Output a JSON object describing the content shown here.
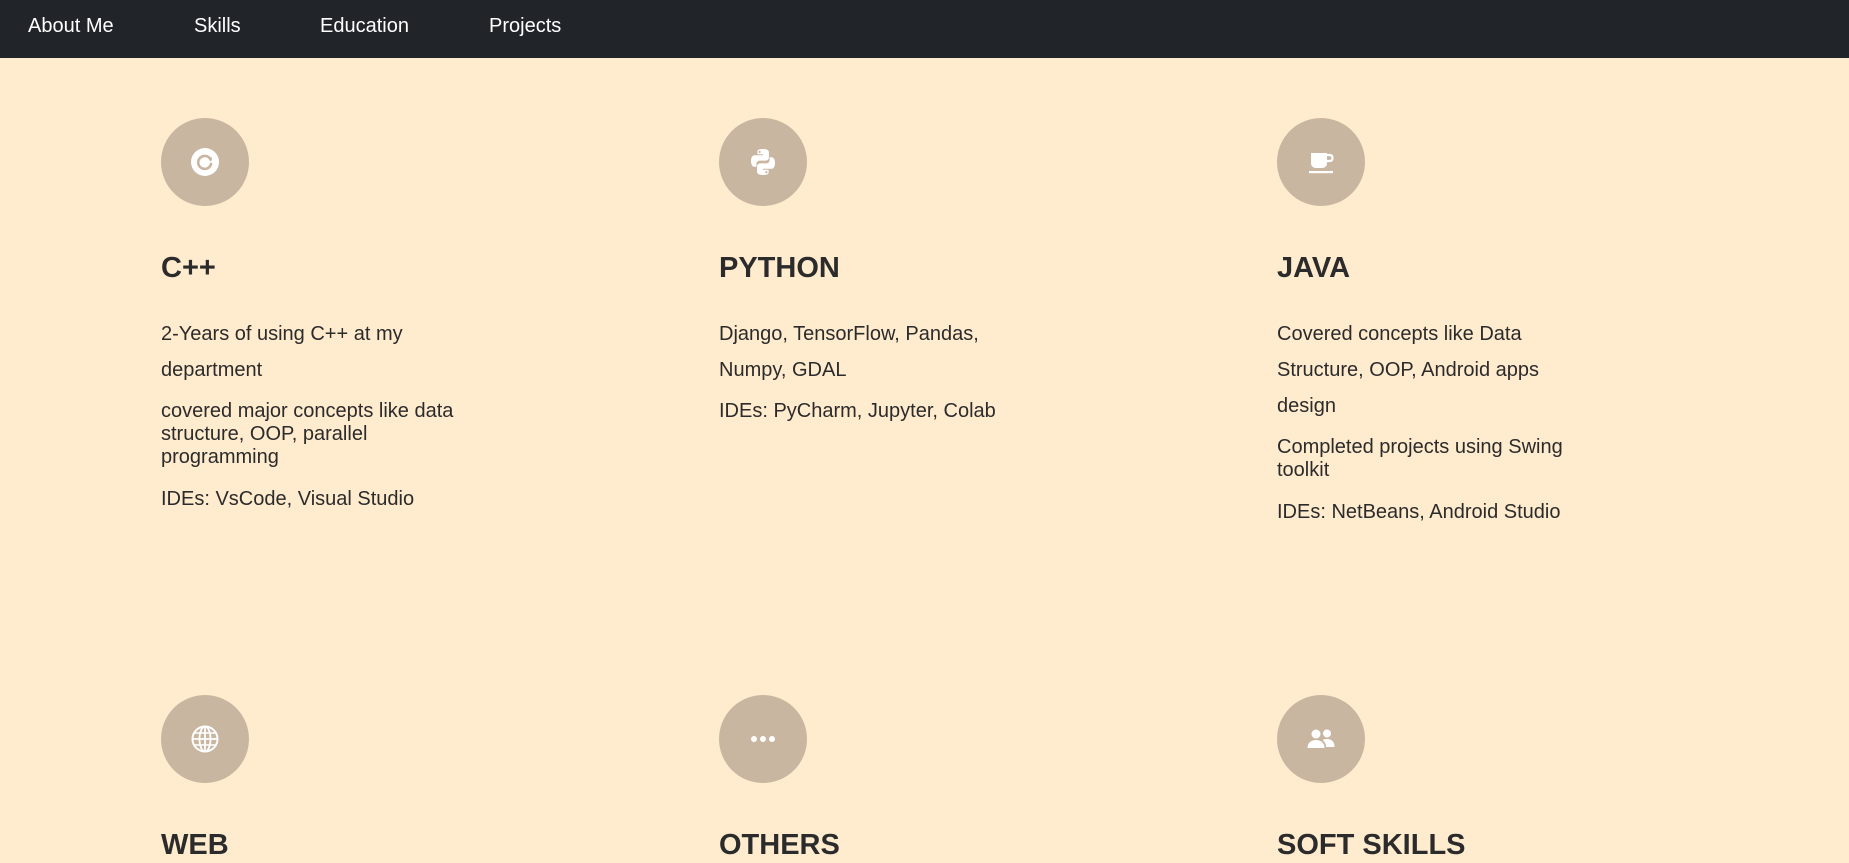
{
  "nav": {
    "items": [
      "About Me",
      "Skills",
      "Education",
      "Projects"
    ]
  },
  "skills": [
    {
      "title": "C++",
      "icon": "refresh-icon",
      "para1": "2-Years of using C++ at my department",
      "para2": "covered major concepts like data structure, OOP, parallel programming",
      "para3": "IDEs: VsCode, Visual Studio"
    },
    {
      "title": "PYTHON",
      "icon": "python-icon",
      "para1": "Django, TensorFlow, Pandas, Numpy, GDAL",
      "para2": "IDEs: PyCharm, Jupyter, Colab"
    },
    {
      "title": "JAVA",
      "icon": "coffee-cup-icon",
      "para1": "Covered concepts like Data Structure, OOP, Android apps design",
      "para2": "Completed projects using Swing toolkit",
      "para3": "IDEs: NetBeans, Android Studio"
    },
    {
      "title": "WEB",
      "icon": "globe-icon"
    },
    {
      "title": "OTHERS",
      "icon": "more-dots-icon"
    },
    {
      "title": "SOFT SKILLS",
      "icon": "people-icon"
    }
  ],
  "colors": {
    "background": "#ffebcd",
    "navbar": "#212529",
    "icon_circle": "#c8b6a1"
  }
}
